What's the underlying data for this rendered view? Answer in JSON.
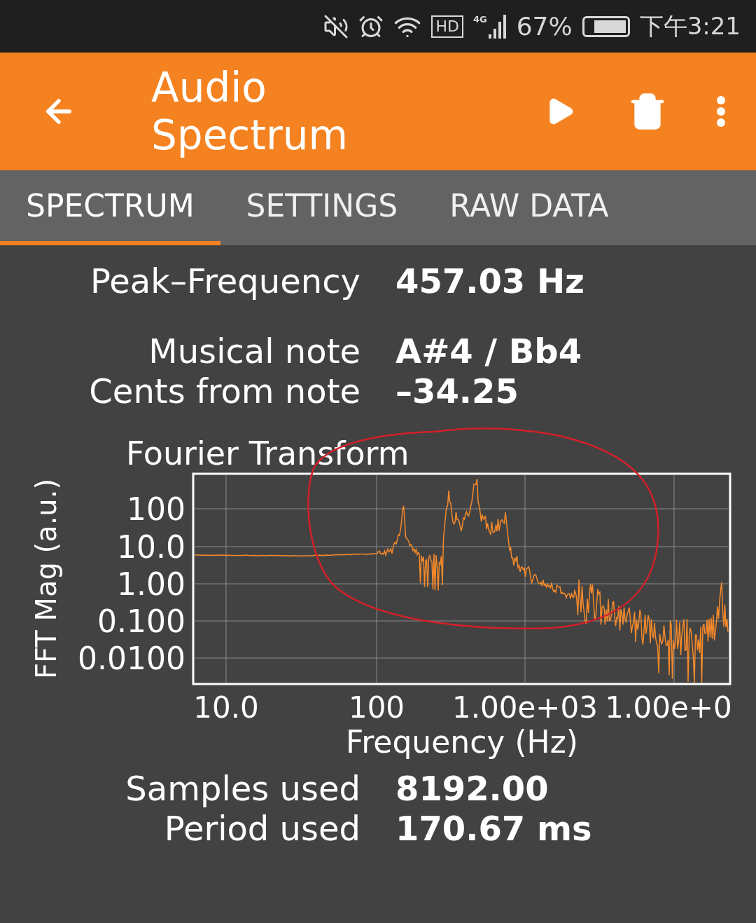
{
  "status_bar": {
    "hd_badge": "HD",
    "network": "4G",
    "battery_percent": "67%",
    "time": "下午3:21"
  },
  "app_bar": {
    "title": "Audio Spectrum"
  },
  "tabs": [
    {
      "label": "SPECTRUM",
      "selected": true
    },
    {
      "label": "SETTINGS",
      "selected": false
    },
    {
      "label": "RAW DATA",
      "selected": false
    }
  ],
  "readings_top": [
    {
      "label": "Peak–Frequency",
      "value": "457.03 Hz"
    }
  ],
  "readings_note": [
    {
      "label": "Musical note",
      "value": "A#4 / Bb4"
    },
    {
      "label": "Cents from note",
      "value": "–34.25"
    }
  ],
  "chart": {
    "title": "Fourier Transform",
    "ylabel": "FFT Mag (a.u.)",
    "xlabel": "Frequency (Hz)",
    "yticks": [
      "100",
      "10.0",
      "1.00",
      "0.100",
      "0.0100"
    ],
    "xticks": [
      "10.0",
      "100",
      "1.00e+03",
      "1.00e+0"
    ]
  },
  "readings_bottom": [
    {
      "label": "Samples used",
      "value": "8192.00"
    },
    {
      "label": "Period used",
      "value": "170.67 ms"
    }
  ]
}
